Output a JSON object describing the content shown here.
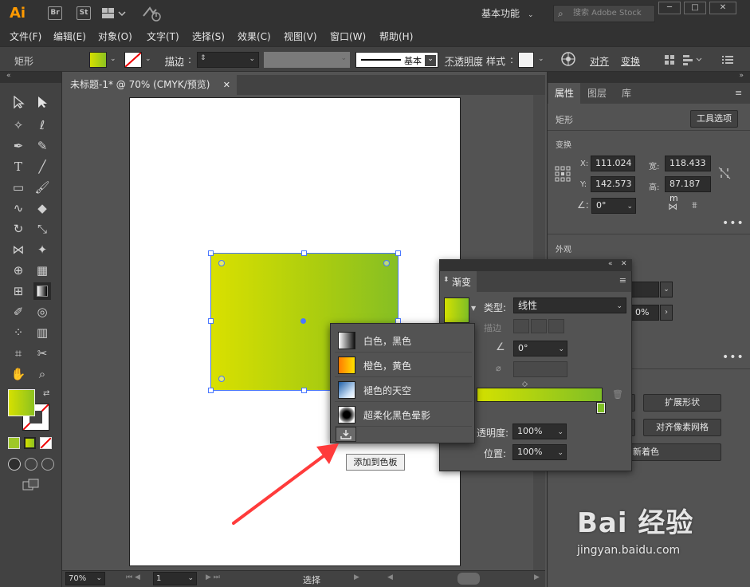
{
  "app": {
    "logo_text": "Ai",
    "bridge_label": "Br",
    "stock_label": "St",
    "workspace": "基本功能",
    "search_placeholder": "搜索 Adobe Stock"
  },
  "menu": [
    "文件(F)",
    "编辑(E)",
    "对象(O)",
    "文字(T)",
    "选择(S)",
    "效果(C)",
    "视图(V)",
    "窗口(W)",
    "帮助(H)"
  ],
  "control": {
    "object_type": "矩形",
    "stroke_label": "描边",
    "brush_preset": "基本",
    "opacity_label": "不透明度",
    "style_label": "样式",
    "align_label": "对齐",
    "transform_label": "变换",
    "fill_color": "#c8dc00"
  },
  "document": {
    "tab_title": "未标题-1* @ 70% (CMYK/预览)"
  },
  "status": {
    "zoom": "70%",
    "page": "1",
    "tool": "选择"
  },
  "properties": {
    "tabs": [
      "属性",
      "图层",
      "库"
    ],
    "section_object": "矩形",
    "tool_options_btn": "工具选项",
    "transform_title": "变换",
    "x_label": "X:",
    "x": "111.024",
    "y_label": "Y:",
    "y": "142.573",
    "w_label": "宽:",
    "w": "118.433",
    "h_label": "高:",
    "h": "87.187 m",
    "angle": "0°",
    "appearance_title": "外观",
    "opacity_partial": "0%",
    "expand_shape_btn": "扩展形状",
    "align_pixel_btn": "对齐像素网格",
    "recolor_partial": "新着色"
  },
  "gradient_panel": {
    "title": "渐变",
    "type_label": "类型:",
    "type_value": "线性",
    "stroke_label": "描边",
    "angle": "0°",
    "opacity_label": "透明度:",
    "opacity": "100%",
    "location_label": "位置:",
    "location": "100%",
    "start_color": "#d4e100",
    "end_color": "#7fbf26"
  },
  "gradient_presets": [
    {
      "label": "白色，黑色",
      "icon": "white-black-swatch"
    },
    {
      "label": "橙色，黄色",
      "icon": "orange-yellow-swatch"
    },
    {
      "label": "褪色的天空",
      "icon": "faded-sky-swatch"
    },
    {
      "label": "超柔化黑色晕影",
      "icon": "soft-black-vignette-swatch"
    }
  ],
  "tooltip": "添加到色板",
  "watermark": {
    "brand": "Bai 经验",
    "url": "jingyan.baidu.com"
  }
}
